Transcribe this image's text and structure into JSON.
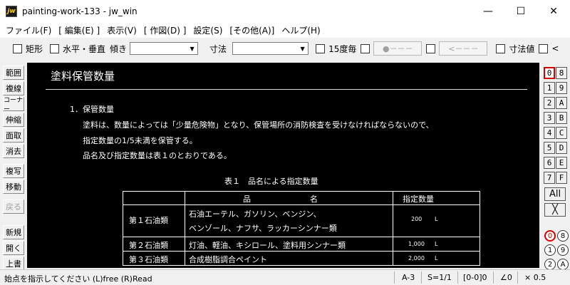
{
  "window": {
    "app_icon": "jw",
    "title": "painting-work-133 - jw_win",
    "minimize": "—",
    "maximize": "☐",
    "close": "✕"
  },
  "menu": [
    "ファイル(F)",
    "[ 編集(E) ]",
    "表示(V)",
    "[ 作図(D) ]",
    "設定(S)",
    "[その他(A)]",
    "ヘルプ(H)"
  ],
  "toolbar": {
    "rect_label": "矩形",
    "hv_label": "水平・垂直",
    "tilt_label": "傾き",
    "tilt_value": "",
    "dim_label": "寸法",
    "dim_value": "",
    "deg15_label": "15度毎",
    "btn1_label": "●－－－",
    "btn2_label": "<－－－",
    "dimval_label": "寸法値",
    "lt_label": "<"
  },
  "left_tools": [
    "範囲",
    "複線",
    "コーナー",
    "伸縮",
    "面取",
    "消去",
    "複写",
    "移動",
    "戻る",
    "新規",
    "開く",
    "上書"
  ],
  "document": {
    "title": "塗料保管数量",
    "section": "1．保管数量",
    "para_line1": "塗料は、数量によっては「少量危険物」となり、保管場所の消防検査を受けなければならないので、",
    "para_line2": "指定数量の1/5未満を保管する。",
    "para_line3": "品名及び指定数量は表１のとおりである。",
    "table_caption": "表１　品名による指定数量",
    "table": {
      "header_name_1": "品",
      "header_name_2": "名",
      "header_qty": "指定数量",
      "rows": [
        {
          "category": "第１石油類",
          "name_line1": "石油エーテル、ガソリン、ベンジン、",
          "name_line2": "ベンゾール、ナフサ、ラッカーシンナー類",
          "qty": "200",
          "unit": "L"
        },
        {
          "category": "第２石油類",
          "name_line1": "灯油、軽油、キシロール、塗料用シンナー類",
          "name_line2": "",
          "qty": "1,000",
          "unit": "L"
        },
        {
          "category": "第３石油類",
          "name_line1": "合成樹脂調合ペイント",
          "name_line2": "",
          "qty": "2,000",
          "unit": "L"
        }
      ]
    }
  },
  "layers": {
    "left": [
      "0",
      "1",
      "2",
      "3",
      "4",
      "5",
      "6",
      "7"
    ],
    "right": [
      "8",
      "9",
      "A",
      "B",
      "C",
      "D",
      "E",
      "F"
    ],
    "all_label": "All",
    "cross_label": "╳",
    "groups_left": [
      "0",
      "1",
      "2"
    ],
    "groups_right": [
      "8",
      "9",
      "A"
    ]
  },
  "status": {
    "message": "始点を指示してください (L)free (R)Read",
    "paper": "A-3",
    "scale": "S=1/1",
    "layer": "[0-0]0",
    "angle": "∠0",
    "factor": "× 0.5"
  }
}
